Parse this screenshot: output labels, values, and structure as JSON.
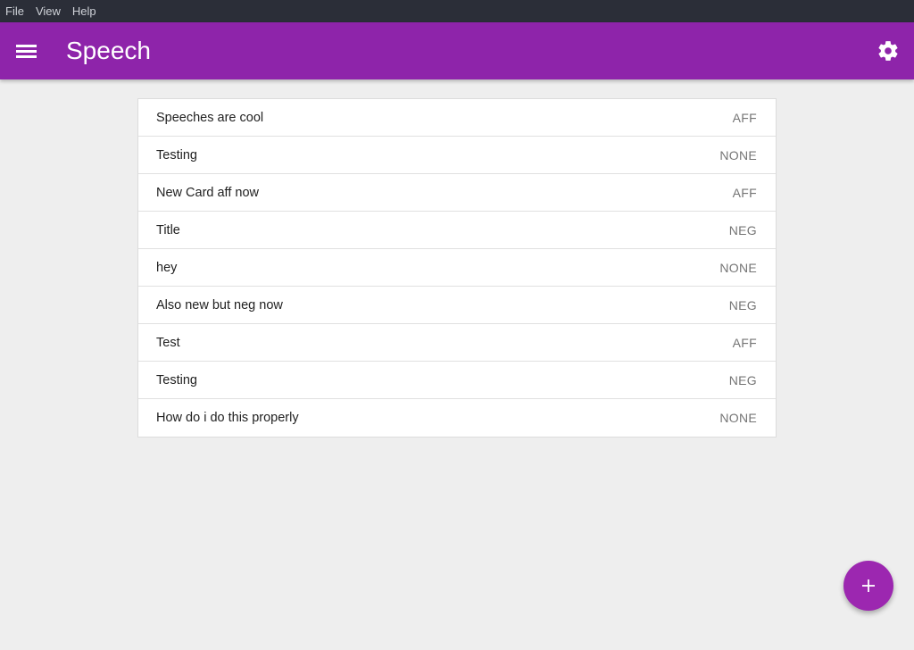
{
  "menubar": {
    "items": [
      "File",
      "View",
      "Help"
    ]
  },
  "appbar": {
    "title": "Speech",
    "menu_icon": "hamburger-menu-icon",
    "settings_icon": "gear-icon",
    "color": "#8e24aa"
  },
  "cards": [
    {
      "title": "Speeches are cool",
      "side": "AFF"
    },
    {
      "title": "Testing",
      "side": "NONE"
    },
    {
      "title": "New Card aff now",
      "side": "AFF"
    },
    {
      "title": "Title",
      "side": "NEG"
    },
    {
      "title": "hey",
      "side": "NONE"
    },
    {
      "title": "Also new but neg now",
      "side": "NEG"
    },
    {
      "title": "Test",
      "side": "AFF"
    },
    {
      "title": "Testing",
      "side": "NEG"
    },
    {
      "title": "How do i do this properly",
      "side": "NONE"
    }
  ],
  "fab": {
    "icon": "plus-icon",
    "color": "#9c27b0"
  }
}
